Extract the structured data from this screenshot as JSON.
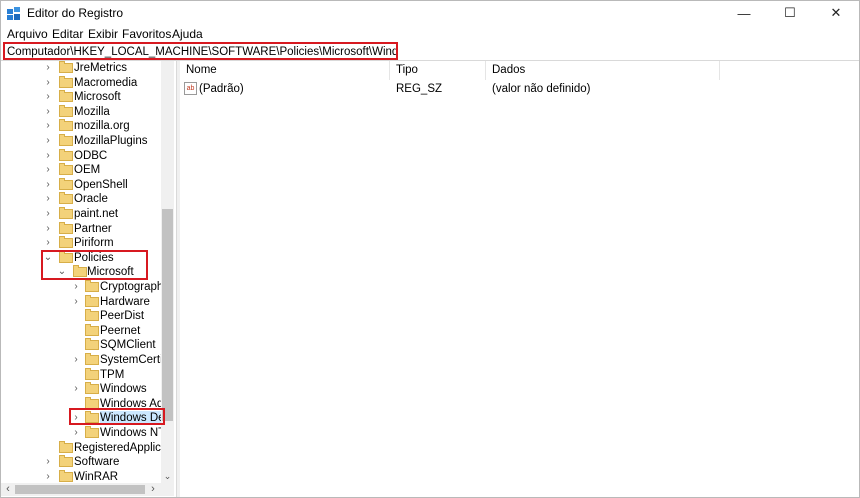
{
  "window": {
    "title": "Editor do Registro",
    "minimize_glyph": "—",
    "maximize_glyph": "☐",
    "close_glyph": "✕"
  },
  "menu": [
    {
      "label": "Arquivo"
    },
    {
      "label": "Editar"
    },
    {
      "label": "Exibir"
    },
    {
      "label": "Favoritos"
    },
    {
      "label": "Ajuda"
    }
  ],
  "address": "Computador\\HKEY_LOCAL_MACHINE\\SOFTWARE\\Policies\\Microsoft\\Windows Defender",
  "tree": [
    {
      "label": "JreMetrics",
      "level": 1,
      "chevron": "›"
    },
    {
      "label": "Macromedia",
      "level": 1,
      "chevron": "›"
    },
    {
      "label": "Microsoft",
      "level": 1,
      "chevron": "›"
    },
    {
      "label": "Mozilla",
      "level": 1,
      "chevron": "›"
    },
    {
      "label": "mozilla.org",
      "level": 1,
      "chevron": "›"
    },
    {
      "label": "MozillaPlugins",
      "level": 1,
      "chevron": "›"
    },
    {
      "label": "ODBC",
      "level": 1,
      "chevron": "›"
    },
    {
      "label": "OEM",
      "level": 1,
      "chevron": "›"
    },
    {
      "label": "OpenShell",
      "level": 1,
      "chevron": "›"
    },
    {
      "label": "Oracle",
      "level": 1,
      "chevron": "›"
    },
    {
      "label": "paint.net",
      "level": 1,
      "chevron": "›"
    },
    {
      "label": "Partner",
      "level": 1,
      "chevron": "›"
    },
    {
      "label": "Piriform",
      "level": 1,
      "chevron": "›"
    },
    {
      "label": "Policies",
      "level": 1,
      "chevron": "⌄"
    },
    {
      "label": "Microsoft",
      "level": 2,
      "chevron": "⌄"
    },
    {
      "label": "Cryptography",
      "level": 3,
      "chevron": "›"
    },
    {
      "label": "Hardware",
      "level": 3,
      "chevron": "›"
    },
    {
      "label": "PeerDist",
      "level": 3,
      "chevron": ""
    },
    {
      "label": "Peernet",
      "level": 3,
      "chevron": ""
    },
    {
      "label": "SQMClient",
      "level": 3,
      "chevron": ""
    },
    {
      "label": "SystemCertific",
      "level": 3,
      "chevron": "›"
    },
    {
      "label": "TPM",
      "level": 3,
      "chevron": ""
    },
    {
      "label": "Windows",
      "level": 3,
      "chevron": "›"
    },
    {
      "label": "Windows Adv",
      "level": 3,
      "chevron": ""
    },
    {
      "label": "Windows Defe",
      "level": 3,
      "chevron": "›",
      "selected": true
    },
    {
      "label": "Windows NT",
      "level": 3,
      "chevron": "›"
    },
    {
      "label": "RegisteredApplicati",
      "level": 1,
      "chevron": ""
    },
    {
      "label": "Software",
      "level": 1,
      "chevron": "›"
    },
    {
      "label": "WinRAR",
      "level": 1,
      "chevron": "›"
    }
  ],
  "scroll": {
    "left_arrow": "‹",
    "right_arrow": "›",
    "down_arrow": "⌄"
  },
  "list": {
    "columns": [
      "Nome",
      "Tipo",
      "Dados"
    ],
    "rows": [
      {
        "icon": "string-value-icon",
        "icon_text": "ab",
        "name": "(Padrão)",
        "type": "REG_SZ",
        "data": "(valor não definido)"
      }
    ]
  },
  "colors": {
    "highlight": "#d71920",
    "selection": "#cce8ff",
    "folder": "#f3d27a"
  }
}
